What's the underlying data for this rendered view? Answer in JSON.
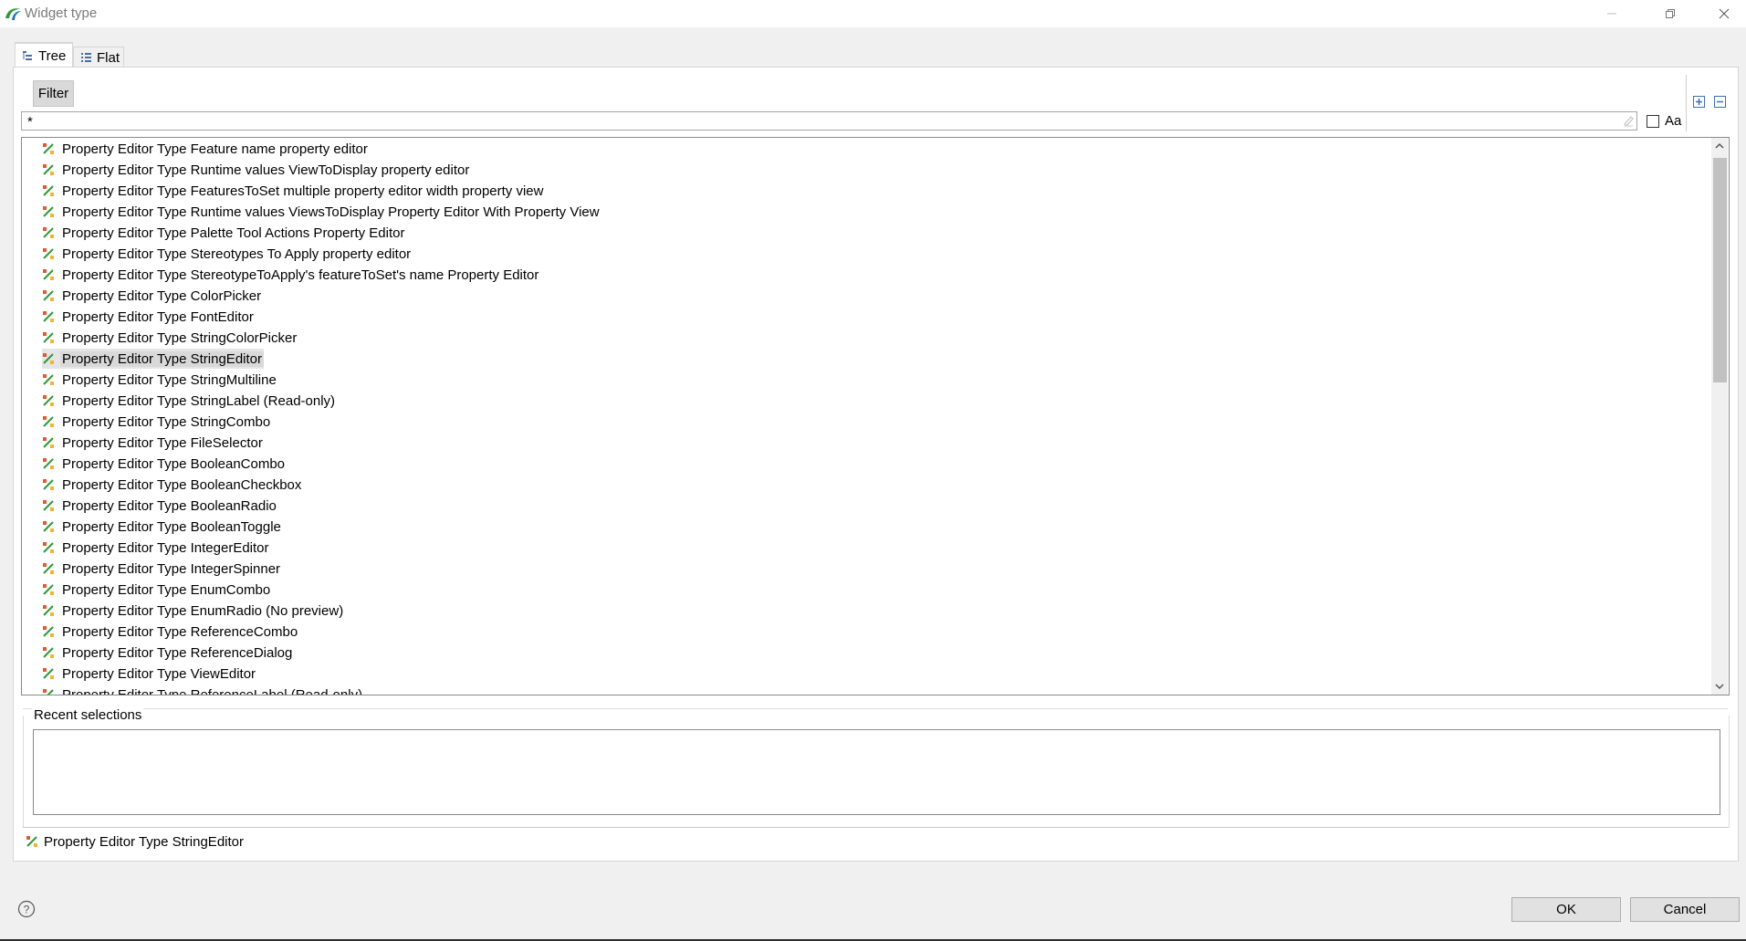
{
  "window": {
    "title": "Widget type",
    "controls": [
      "minimize-icon",
      "restore-icon",
      "close-icon"
    ]
  },
  "tabs": [
    {
      "label": "Tree",
      "icon": "tree-icon",
      "selected": true
    },
    {
      "label": "Flat",
      "icon": "list-icon",
      "selected": false
    }
  ],
  "filter": {
    "button_label": "Filter",
    "input_value": "*",
    "case_sensitive_label": "Aa",
    "case_sensitive_checked": false
  },
  "tree": {
    "items": [
      "Property Editor Type Feature name property editor",
      "Property Editor Type Runtime values ViewToDisplay property editor",
      "Property Editor Type FeaturesToSet multiple property editor width property view",
      "Property Editor Type Runtime values ViewsToDisplay Property Editor With Property View",
      "Property Editor Type Palette Tool Actions Property Editor",
      "Property Editor Type Stereotypes To Apply property editor",
      "Property Editor Type StereotypeToApply's featureToSet's name Property Editor",
      "Property Editor Type ColorPicker",
      "Property Editor Type FontEditor",
      "Property Editor Type StringColorPicker",
      "Property Editor Type StringEditor",
      "Property Editor Type StringMultiline",
      "Property Editor Type StringLabel (Read-only)",
      "Property Editor Type StringCombo",
      "Property Editor Type FileSelector",
      "Property Editor Type BooleanCombo",
      "Property Editor Type BooleanCheckbox",
      "Property Editor Type BooleanRadio",
      "Property Editor Type BooleanToggle",
      "Property Editor Type IntegerEditor",
      "Property Editor Type IntegerSpinner",
      "Property Editor Type EnumCombo",
      "Property Editor Type EnumRadio (No preview)",
      "Property Editor Type ReferenceCombo",
      "Property Editor Type ReferenceDialog",
      "Property Editor Type ViewEditor",
      "Property Editor Type ReferenceLabel (Read-only)"
    ],
    "selected_index": 10,
    "item_icon": "property-editor-icon"
  },
  "recent": {
    "label": "Recent selections",
    "items": []
  },
  "status": {
    "text": "Property Editor Type StringEditor"
  },
  "buttons": {
    "ok": "OK",
    "cancel": "Cancel"
  }
}
